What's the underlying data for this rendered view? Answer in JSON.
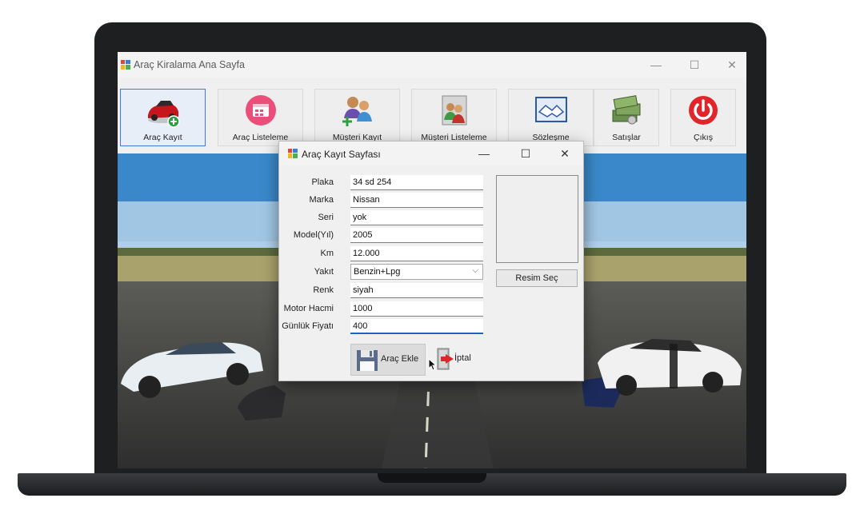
{
  "app": {
    "title": "Araç Kiralama Ana Sayfa",
    "window_controls": {
      "minimize": "—",
      "maximize": "☐",
      "close": "✕"
    }
  },
  "toolbar": {
    "buttons": [
      {
        "label": "Araç Kayıt",
        "icon": "car-add-icon"
      },
      {
        "label": "Araç Listeleme",
        "icon": "list-calendar-icon"
      },
      {
        "label": "Müşteri Kayıt",
        "icon": "customer-add-icon"
      },
      {
        "label": "Müşteri Listeleme",
        "icon": "customer-list-icon"
      },
      {
        "label": "Sözleşme",
        "icon": "handshake-icon"
      },
      {
        "label": "Satışlar",
        "icon": "money-stack-icon"
      },
      {
        "label": "Çıkış",
        "icon": "power-icon"
      }
    ]
  },
  "dialog": {
    "title": "Araç  Kayıt Sayfası",
    "controls": {
      "minimize": "—",
      "maximize": "☐",
      "close": "✕"
    },
    "fields": [
      {
        "label": "Plaka",
        "value": "34 sd 254"
      },
      {
        "label": "Marka",
        "value": "Nissan"
      },
      {
        "label": "Seri",
        "value": "yok"
      },
      {
        "label": "Model(Yıl)",
        "value": "2005"
      },
      {
        "label": "Km",
        "value": "12.000"
      },
      {
        "label": "Yakıt",
        "value": "Benzin+Lpg"
      },
      {
        "label": "Renk",
        "value": "siyah"
      },
      {
        "label": "Motor Hacmi",
        "value": "1000"
      },
      {
        "label": "Günlük Fiyatı",
        "value": "400"
      }
    ],
    "select_chevron": "⌵",
    "pick_image_label": "Resim Seç",
    "add_button_label": "Araç Ekle",
    "cancel_button_label": "İptal"
  },
  "colors": {
    "accent_blue": "#1d63c4",
    "active_border": "#3f7ae0",
    "bezel": "#1d1f21",
    "power_red": "#e0262a"
  }
}
